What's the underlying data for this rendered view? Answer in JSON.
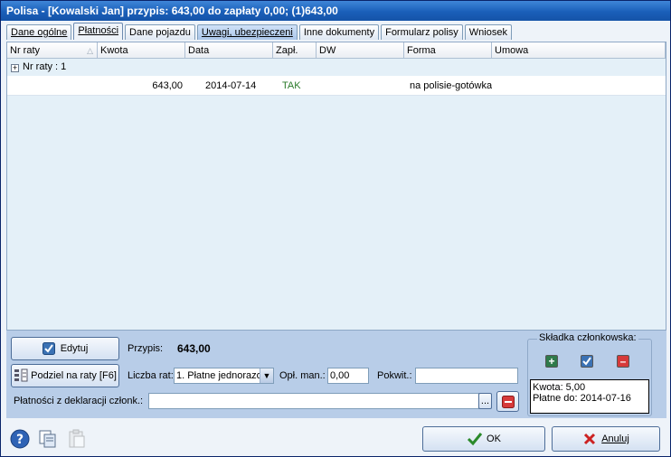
{
  "window": {
    "title": "Polisa - [Kowalski Jan]  przypis: 643,00 do zapłaty 0,00; (1)643,00"
  },
  "tabs": [
    {
      "label": "Dane ogólne"
    },
    {
      "label": "Płatności"
    },
    {
      "label": "Dane pojazdu"
    },
    {
      "label": "Uwagi, ubezpieczeni"
    },
    {
      "label": "Inne dokumenty"
    },
    {
      "label": "Formularz polisy"
    },
    {
      "label": "Wniosek"
    }
  ],
  "grid": {
    "columns": [
      "Nr raty",
      "Kwota",
      "Data",
      "Zapł.",
      "DW",
      "Forma",
      "Umowa"
    ],
    "group_label": "Nr raty : 1",
    "rows": [
      {
        "kwota": "643,00",
        "data": "2014-07-14",
        "zapl": "TAK",
        "dw": "",
        "forma": "na polisie-gotówka",
        "umowa": ""
      }
    ]
  },
  "panel": {
    "edit_label": "Edytuj",
    "split_label": "Podziel na raty [F6]",
    "przypis_label": "Przypis:",
    "przypis_value": "643,00",
    "liczba_rat_label": "Liczba rat:",
    "liczba_rat_value": "1. Płatne jednorazo",
    "opl_man_label": "Opł. man.:",
    "opl_man_value": "0,00",
    "pokwit_label": "Pokwit.:",
    "pokwit_value": "",
    "deklaracje_label": "Płatności z deklaracji członk.:",
    "deklaracje_value": "",
    "browse_label": "...",
    "membership": {
      "legend": "Składka członkowska:",
      "kwota": "Kwota: 5,00",
      "platne_do": "Płatne do: 2014-07-16"
    }
  },
  "footer": {
    "ok_label": "OK",
    "cancel_label": "Anuluj"
  },
  "colors": {
    "title_bar": "#1a5fb9",
    "paid": "#2a7a2a",
    "panel_bg": "#b8cde8",
    "grid_bg": "#e4f0f8"
  },
  "icons": [
    "help-icon",
    "copy-icon",
    "paste-icon",
    "checkmark-icon",
    "split-icon",
    "remove-icon",
    "add-icon",
    "ok-check-icon",
    "cancel-x-icon"
  ]
}
